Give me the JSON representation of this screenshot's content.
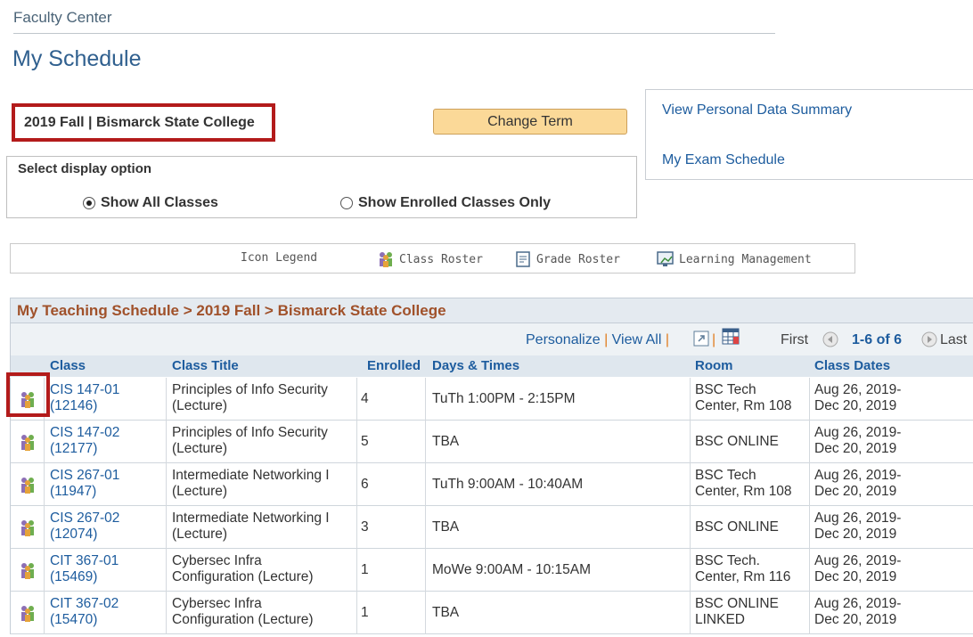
{
  "header": {
    "breadcrumb": "Faculty Center",
    "title": "My Schedule"
  },
  "term": {
    "label": "2019 Fall | Bismarck State College",
    "change_button": "Change Term"
  },
  "side_links": {
    "personal_data": "View Personal Data Summary",
    "exam_schedule": "My Exam Schedule"
  },
  "display": {
    "label": "Select display option",
    "options": [
      {
        "label": "Show All Classes",
        "selected": true
      },
      {
        "label": "Show Enrolled Classes Only",
        "selected": false
      }
    ]
  },
  "legend": {
    "title": "Icon Legend",
    "items": [
      {
        "label": "Class Roster",
        "icon": "class-roster-icon"
      },
      {
        "label": "Grade Roster",
        "icon": "grade-roster-icon"
      },
      {
        "label": "Learning Management",
        "icon": "learning-management-icon"
      }
    ]
  },
  "schedule": {
    "header": "My Teaching Schedule > 2019 Fall > Bismarck State College",
    "nav": {
      "personalize": "Personalize",
      "view_all": "View All",
      "first": "First",
      "range": "1-6 of 6",
      "last": "Last"
    },
    "columns": {
      "class": "Class",
      "title": "Class Title",
      "enrolled": "Enrolled",
      "days_times": "Days & Times",
      "room": "Room",
      "dates": "Class Dates"
    },
    "rows": [
      {
        "class_l1": "CIS 147-01",
        "class_l2": "(12146)",
        "title_l1": "Principles of Info Security",
        "title_l2": "(Lecture)",
        "enrolled": "4",
        "days_times": "TuTh 1:00PM - 2:15PM",
        "room_l1": "BSC Tech",
        "room_l2": "Center, Rm 108",
        "dates_l1": "Aug 26, 2019-",
        "dates_l2": "Dec 20, 2019"
      },
      {
        "class_l1": "CIS 147-02",
        "class_l2": "(12177)",
        "title_l1": "Principles of Info Security",
        "title_l2": "(Lecture)",
        "enrolled": "5",
        "days_times": "TBA",
        "room_l1": "BSC ONLINE",
        "room_l2": "",
        "dates_l1": "Aug 26, 2019-",
        "dates_l2": "Dec 20, 2019"
      },
      {
        "class_l1": "CIS 267-01",
        "class_l2": "(11947)",
        "title_l1": "Intermediate Networking I",
        "title_l2": "(Lecture)",
        "enrolled": "6",
        "days_times": "TuTh 9:00AM - 10:40AM",
        "room_l1": "BSC Tech",
        "room_l2": "Center, Rm 108",
        "dates_l1": "Aug 26, 2019-",
        "dates_l2": "Dec 20, 2019"
      },
      {
        "class_l1": "CIS 267-02",
        "class_l2": "(12074)",
        "title_l1": "Intermediate Networking I",
        "title_l2": "(Lecture)",
        "enrolled": "3",
        "days_times": "TBA",
        "room_l1": "BSC ONLINE",
        "room_l2": "",
        "dates_l1": "Aug 26, 2019-",
        "dates_l2": "Dec 20, 2019"
      },
      {
        "class_l1": "CIT 367-01",
        "class_l2": "(15469)",
        "title_l1": "Cybersec Infra",
        "title_l2": "Configuration (Lecture)",
        "enrolled": "1",
        "days_times": "MoWe 9:00AM - 10:15AM",
        "room_l1": "BSC Tech.",
        "room_l2": "Center, Rm 116",
        "dates_l1": "Aug 26, 2019-",
        "dates_l2": "Dec 20, 2019"
      },
      {
        "class_l1": "CIT 367-02",
        "class_l2": "(15470)",
        "title_l1": "Cybersec Infra",
        "title_l2": "Configuration (Lecture)",
        "enrolled": "1",
        "days_times": "TBA",
        "room_l1": "BSC ONLINE",
        "room_l2": "LINKED",
        "dates_l1": "Aug 26, 2019-",
        "dates_l2": "Dec 20, 2019"
      }
    ]
  },
  "colors": {
    "link": "#1d5c9e",
    "accent_header": "#a0512a",
    "highlight": "#b31b1b",
    "button": "#fbd998"
  }
}
